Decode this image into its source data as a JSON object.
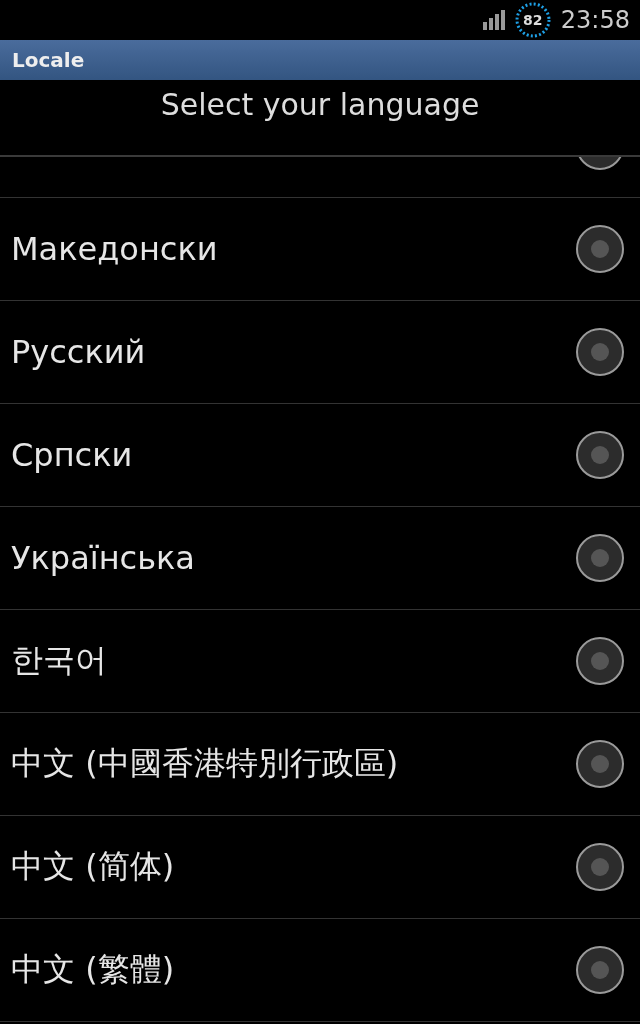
{
  "status_bar": {
    "battery": "82",
    "time": "23:58"
  },
  "window": {
    "title": "Locale"
  },
  "dialog": {
    "title": "Select your language"
  },
  "languages": [
    {
      "kind": "cut_off"
    },
    {
      "label": "Македонски",
      "selected": false
    },
    {
      "label": "Русский",
      "selected": false
    },
    {
      "label": "Српски",
      "selected": false
    },
    {
      "label": "Українська",
      "selected": false
    },
    {
      "label": "한국어",
      "selected": false
    },
    {
      "label": "中文 (中國香港特別行政區)",
      "selected": false
    },
    {
      "label": "中文 (简体)",
      "selected": false
    },
    {
      "label": "中文 (繁體)",
      "selected": false
    }
  ]
}
